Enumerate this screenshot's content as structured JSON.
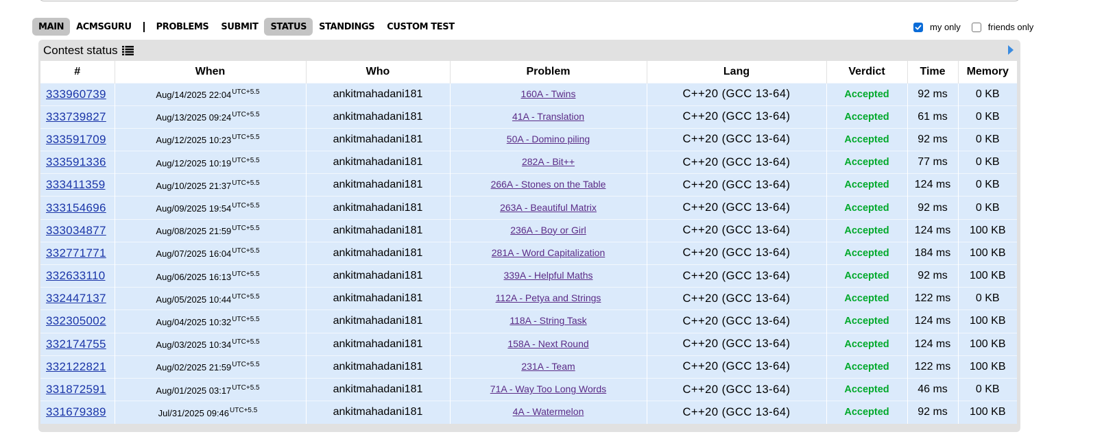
{
  "menu": {
    "items": [
      {
        "label": "Main",
        "active": true
      },
      {
        "label": "acmsguru",
        "active": false
      },
      {
        "label": "Problems",
        "active": false
      },
      {
        "label": "Submit",
        "active": false
      },
      {
        "label": "Status",
        "active": true
      },
      {
        "label": "Standings",
        "active": false
      },
      {
        "label": "Custom Test",
        "active": false
      }
    ]
  },
  "filters": {
    "my_only": {
      "label": "my only",
      "checked": true
    },
    "friends_only": {
      "label": "friends only",
      "checked": false
    }
  },
  "panel": {
    "title": "Contest status",
    "title_icon": "list-icon",
    "nav_icon": "arrow-right-icon"
  },
  "table": {
    "headers": [
      "#",
      "When",
      "Who",
      "Problem",
      "Lang",
      "Verdict",
      "Time",
      "Memory"
    ],
    "rows": [
      {
        "id": "333960739",
        "when": "Aug/14/2025 22:04",
        "tz": "UTC+5.5",
        "who": "ankitmahadani181",
        "problem": "160A - Twins",
        "lang": "C++20 (GCC 13-64)",
        "verdict": "Accepted",
        "time": "92 ms",
        "memory": "0 KB"
      },
      {
        "id": "333739827",
        "when": "Aug/13/2025 09:24",
        "tz": "UTC+5.5",
        "who": "ankitmahadani181",
        "problem": "41A - Translation",
        "lang": "C++20 (GCC 13-64)",
        "verdict": "Accepted",
        "time": "61 ms",
        "memory": "0 KB"
      },
      {
        "id": "333591709",
        "when": "Aug/12/2025 10:23",
        "tz": "UTC+5.5",
        "who": "ankitmahadani181",
        "problem": "50A - Domino piling",
        "lang": "C++20 (GCC 13-64)",
        "verdict": "Accepted",
        "time": "92 ms",
        "memory": "0 KB"
      },
      {
        "id": "333591336",
        "when": "Aug/12/2025 10:19",
        "tz": "UTC+5.5",
        "who": "ankitmahadani181",
        "problem": "282A - Bit++",
        "lang": "C++20 (GCC 13-64)",
        "verdict": "Accepted",
        "time": "77 ms",
        "memory": "0 KB"
      },
      {
        "id": "333411359",
        "when": "Aug/10/2025 21:37",
        "tz": "UTC+5.5",
        "who": "ankitmahadani181",
        "problem": "266A - Stones on the Table",
        "lang": "C++20 (GCC 13-64)",
        "verdict": "Accepted",
        "time": "124 ms",
        "memory": "0 KB"
      },
      {
        "id": "333154696",
        "when": "Aug/09/2025 19:54",
        "tz": "UTC+5.5",
        "who": "ankitmahadani181",
        "problem": "263A - Beautiful Matrix",
        "lang": "C++20 (GCC 13-64)",
        "verdict": "Accepted",
        "time": "92 ms",
        "memory": "0 KB"
      },
      {
        "id": "333034877",
        "when": "Aug/08/2025 21:59",
        "tz": "UTC+5.5",
        "who": "ankitmahadani181",
        "problem": "236A - Boy or Girl",
        "lang": "C++20 (GCC 13-64)",
        "verdict": "Accepted",
        "time": "124 ms",
        "memory": "100 KB"
      },
      {
        "id": "332771771",
        "when": "Aug/07/2025 16:04",
        "tz": "UTC+5.5",
        "who": "ankitmahadani181",
        "problem": "281A - Word Capitalization",
        "lang": "C++20 (GCC 13-64)",
        "verdict": "Accepted",
        "time": "184 ms",
        "memory": "100 KB"
      },
      {
        "id": "332633110",
        "when": "Aug/06/2025 16:13",
        "tz": "UTC+5.5",
        "who": "ankitmahadani181",
        "problem": "339A - Helpful Maths",
        "lang": "C++20 (GCC 13-64)",
        "verdict": "Accepted",
        "time": "92 ms",
        "memory": "100 KB"
      },
      {
        "id": "332447137",
        "when": "Aug/05/2025 10:44",
        "tz": "UTC+5.5",
        "who": "ankitmahadani181",
        "problem": "112A - Petya and Strings",
        "lang": "C++20 (GCC 13-64)",
        "verdict": "Accepted",
        "time": "122 ms",
        "memory": "0 KB"
      },
      {
        "id": "332305002",
        "when": "Aug/04/2025 10:32",
        "tz": "UTC+5.5",
        "who": "ankitmahadani181",
        "problem": "118A - String Task",
        "lang": "C++20 (GCC 13-64)",
        "verdict": "Accepted",
        "time": "124 ms",
        "memory": "100 KB"
      },
      {
        "id": "332174755",
        "when": "Aug/03/2025 10:34",
        "tz": "UTC+5.5",
        "who": "ankitmahadani181",
        "problem": "158A - Next Round",
        "lang": "C++20 (GCC 13-64)",
        "verdict": "Accepted",
        "time": "124 ms",
        "memory": "100 KB"
      },
      {
        "id": "332122821",
        "when": "Aug/02/2025 21:59",
        "tz": "UTC+5.5",
        "who": "ankitmahadani181",
        "problem": "231A - Team",
        "lang": "C++20 (GCC 13-64)",
        "verdict": "Accepted",
        "time": "122 ms",
        "memory": "100 KB"
      },
      {
        "id": "331872591",
        "when": "Aug/01/2025 03:17",
        "tz": "UTC+5.5",
        "who": "ankitmahadani181",
        "problem": "71A - Way Too Long Words",
        "lang": "C++20 (GCC 13-64)",
        "verdict": "Accepted",
        "time": "46 ms",
        "memory": "0 KB"
      },
      {
        "id": "331679389",
        "when": "Jul/31/2025 09:46",
        "tz": "UTC+5.5",
        "who": "ankitmahadani181",
        "problem": "4A - Watermelon",
        "lang": "C++20 (GCC 13-64)",
        "verdict": "Accepted",
        "time": "92 ms",
        "memory": "100 KB"
      }
    ]
  },
  "colors": {
    "accent_link": "#1a35a8",
    "problem_link": "#5a2a86",
    "accepted": "#00a92a",
    "row_bg": "#dbeafb",
    "panel_bg": "#e1e1e1",
    "checkbox": "#0b6cd8"
  }
}
